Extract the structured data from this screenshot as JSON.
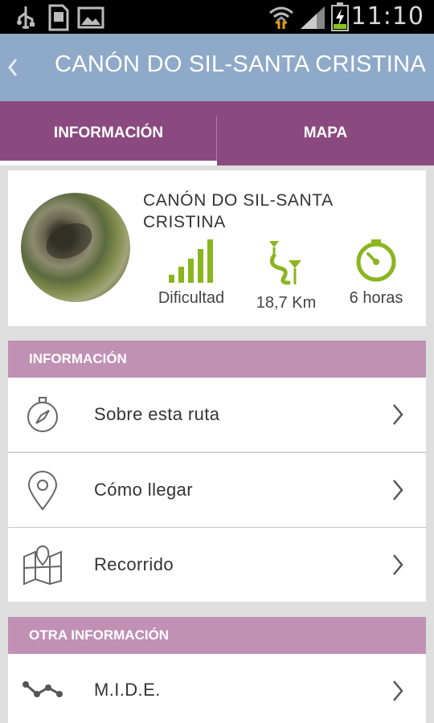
{
  "status_bar": {
    "time": "11:10",
    "icons": [
      "usb-icon",
      "sd-card-icon",
      "image-icon",
      "wifi-icon",
      "signal-icon",
      "battery-charging-icon"
    ]
  },
  "action_bar": {
    "title": "CANÓN DO SIL-SANTA CRISTINA",
    "back_icon": "chevron-left-icon"
  },
  "tabs": [
    {
      "label": "INFORMACIÓN",
      "selected": true
    },
    {
      "label": "MAPA",
      "selected": false
    }
  ],
  "route": {
    "name": "CANÓN DO SIL-SANTA CRISTINA",
    "stats": [
      {
        "icon": "difficulty-bars-icon",
        "label": "Dificultad"
      },
      {
        "icon": "route-distance-icon",
        "label": "18,7 Km"
      },
      {
        "icon": "stopwatch-icon",
        "label": "6 horas"
      }
    ]
  },
  "sections": [
    {
      "header": "INFORMACIÓN",
      "items": [
        {
          "icon": "compass-icon",
          "label": "Sobre esta ruta"
        },
        {
          "icon": "location-pin-icon",
          "label": "Cómo llegar"
        },
        {
          "icon": "map-icon",
          "label": "Recorrido"
        }
      ]
    },
    {
      "header": "OTRA INFORMACIÓN",
      "items": [
        {
          "icon": "polyline-icon",
          "label": "M.I.D.E."
        }
      ]
    }
  ],
  "colors": {
    "action_bar": "#8fa9c8",
    "tabs": "#8b4a7f",
    "section_header": "#c090b5",
    "accent_green": "#8ab51e"
  }
}
